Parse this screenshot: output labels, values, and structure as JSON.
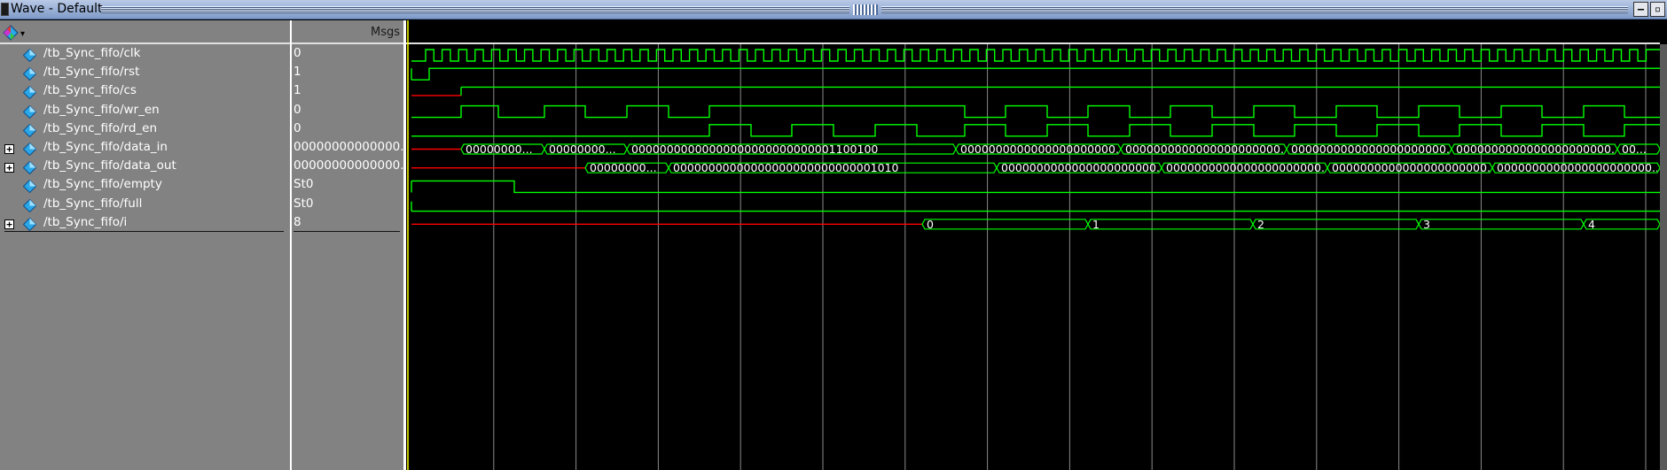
{
  "window": {
    "title": "Wave - Default"
  },
  "header": {
    "value_col": "Msgs"
  },
  "signals": [
    {
      "name": "/tb_Sync_fifo/clk",
      "value": "0",
      "expandable": false
    },
    {
      "name": "/tb_Sync_fifo/rst",
      "value": "1",
      "expandable": false
    },
    {
      "name": "/tb_Sync_fifo/cs",
      "value": "1",
      "expandable": false
    },
    {
      "name": "/tb_Sync_fifo/wr_en",
      "value": "0",
      "expandable": false
    },
    {
      "name": "/tb_Sync_fifo/rd_en",
      "value": "0",
      "expandable": false
    },
    {
      "name": "/tb_Sync_fifo/data_in",
      "value": "00000000000000...",
      "expandable": true
    },
    {
      "name": "/tb_Sync_fifo/data_out",
      "value": "00000000000000...",
      "expandable": true
    },
    {
      "name": "/tb_Sync_fifo/empty",
      "value": "St0",
      "expandable": false
    },
    {
      "name": "/tb_Sync_fifo/full",
      "value": "St0",
      "expandable": false
    },
    {
      "name": "/tb_Sync_fifo/i",
      "value": "8",
      "expandable": true
    }
  ],
  "bus_labels": {
    "data_in": [
      "00000000...",
      "00000000...",
      "00000000000000000000000000001100100",
      "0000000000000000000000...",
      "0000000000000000000000...",
      "0000000000000000000000...",
      "0000000000000000000000...",
      "00..."
    ],
    "data_out": [
      "00000000...",
      "00000000000000000000000000001010",
      "0000000000000000000000...",
      "0000000000000000000000...",
      "0000000000000000000000...",
      "0000000000000000000000..."
    ],
    "i": [
      "0",
      "1",
      "2",
      "3",
      "4"
    ]
  },
  "colors": {
    "wave": "#00ff00",
    "undefined": "#ff0000",
    "cursor": "#ffff00",
    "grid": "#8a8a8a",
    "pane_bg": "#828282",
    "signal_icon": "#2aa7e8"
  },
  "icons": {
    "signal": "signal-diamond-icon",
    "expand": "expand-plus-icon",
    "wave_logo": "wave-logo-icon",
    "minimize": "minimize-icon",
    "restore": "restore-icon"
  }
}
